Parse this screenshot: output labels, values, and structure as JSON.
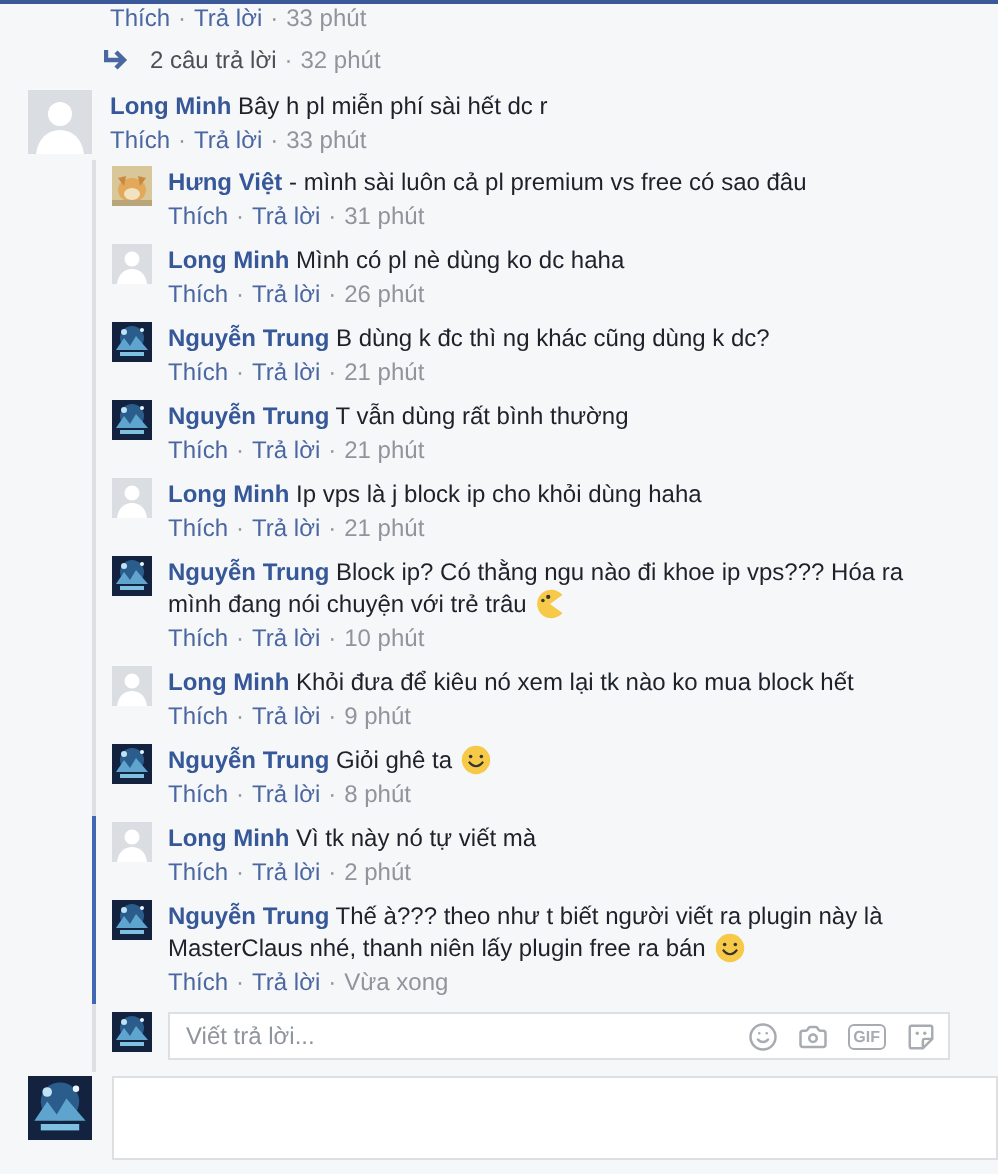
{
  "separator": "·",
  "top_meta": {
    "like": "Thích",
    "reply": "Trả lời",
    "time": "33 phút"
  },
  "replies_link": {
    "text": "2 câu trả lời",
    "time": "32 phút"
  },
  "comment": {
    "author": "Long Minh",
    "avatar": {
      "kind": "default"
    },
    "text": "Bây h pl miễn phí sài hết dc r",
    "like": "Thích",
    "reply": "Trả lời",
    "time": "33 phút",
    "replies": [
      {
        "author": "Hưng Việt",
        "avatar": {
          "kind": "dog"
        },
        "highlighted": false,
        "text": "- mình sài luôn cả pl premium vs free có sao đâu",
        "like": "Thích",
        "reply": "Trả lời",
        "time": "31 phút"
      },
      {
        "author": "Long Minh",
        "avatar": {
          "kind": "default"
        },
        "highlighted": false,
        "text": "Mình có pl nè dùng ko dc haha",
        "like": "Thích",
        "reply": "Trả lời",
        "time": "26 phút"
      },
      {
        "author": "Nguyễn Trung",
        "highlighted": false,
        "text": "B dùng k đc thì ng khác cũng dùng k dc?",
        "like": "Thích",
        "reply": "Trả lời",
        "time": "21 phút"
      },
      {
        "author": "Nguyễn Trung",
        "highlighted": false,
        "text": "T vẫn dùng rất bình thường",
        "like": "Thích",
        "reply": "Trả lời",
        "time": "21 phút"
      },
      {
        "author": "Long Minh",
        "avatar": {
          "kind": "default"
        },
        "highlighted": false,
        "text": "Ip vps là j block ip cho khỏi dùng haha",
        "like": "Thích",
        "reply": "Trả lời",
        "time": "21 phút"
      },
      {
        "author": "Nguyễn Trung",
        "highlighted": false,
        "text": "Block ip? Có thằng ngu nào đi khoe ip vps??? Hóa ra mình đang nói chuyện với trẻ trâu",
        "emoji": {
          "kind": "pacman"
        },
        "like": "Thích",
        "reply": "Trả lời",
        "time": "10 phút"
      },
      {
        "author": "Long Minh",
        "avatar": {
          "kind": "default"
        },
        "highlighted": false,
        "text": "Khỏi đưa để kiêu nó xem lại tk nào ko mua block hết",
        "like": "Thích",
        "reply": "Trả lời",
        "time": "9 phút"
      },
      {
        "author": "Nguyễn Trung",
        "highlighted": false,
        "text": "Giỏi ghê ta",
        "emoji": {
          "kind": "smile"
        },
        "like": "Thích",
        "reply": "Trả lời",
        "time": "8 phút"
      },
      {
        "author": "Long Minh",
        "avatar": {
          "kind": "default"
        },
        "highlighted": true,
        "text": "Vì tk này nó tự viết mà",
        "like": "Thích",
        "reply": "Trả lời",
        "time": "2 phút"
      },
      {
        "author": "Nguyễn Trung",
        "highlighted": true,
        "text": "Thế à??? theo như t biết người viết ra plugin này là MasterClaus nhé, thanh niên lấy plugin free ra bán",
        "emoji": {
          "kind": "smile"
        },
        "like": "Thích",
        "reply": "Trả lời",
        "time": "Vừa xong"
      }
    ]
  },
  "reply_box": {
    "placeholder": "Viết trả lời...",
    "gif_label": "GIF"
  }
}
